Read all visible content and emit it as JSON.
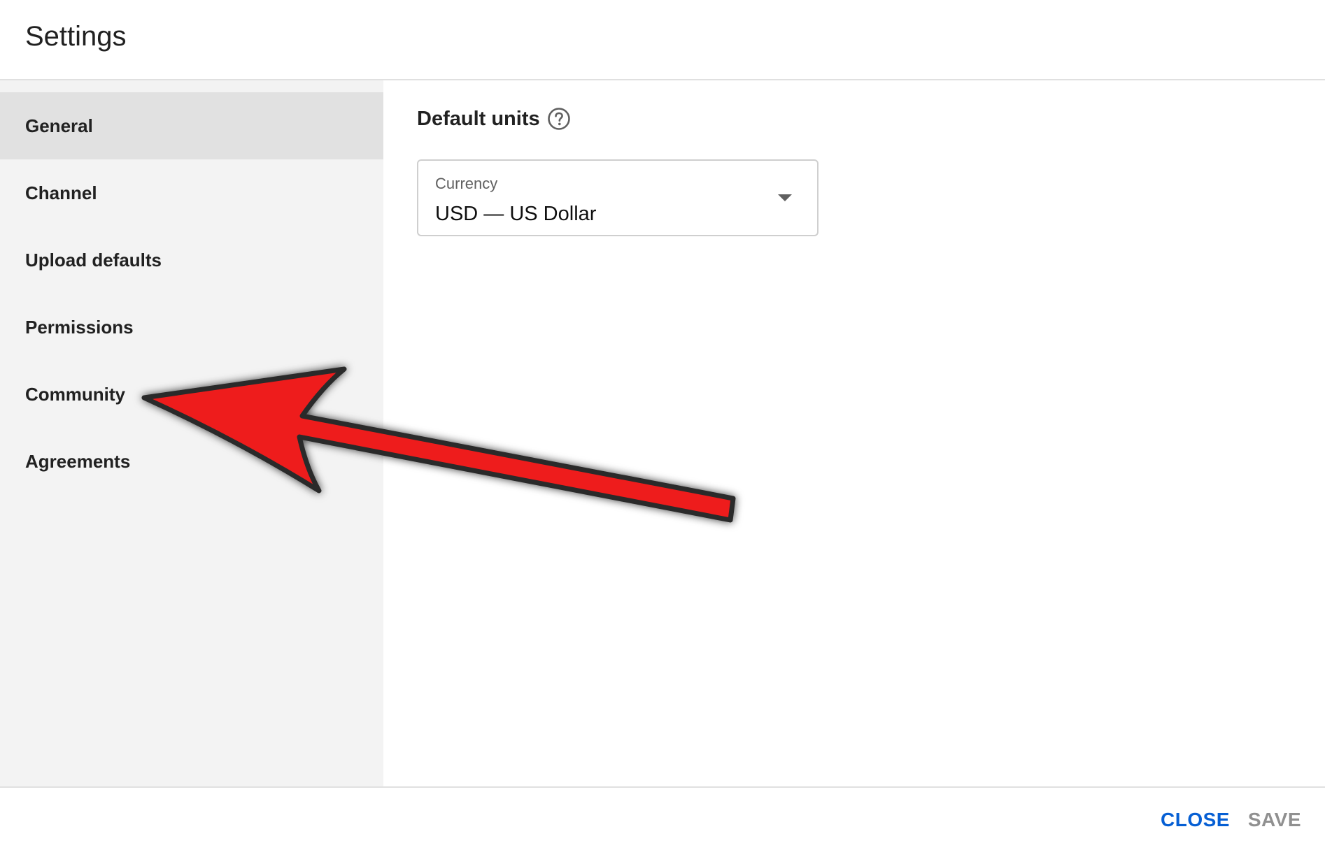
{
  "dialog": {
    "title": "Settings"
  },
  "sidebar": {
    "items": [
      {
        "label": "General",
        "active": true
      },
      {
        "label": "Channel",
        "active": false
      },
      {
        "label": "Upload defaults",
        "active": false
      },
      {
        "label": "Permissions",
        "active": false
      },
      {
        "label": "Community",
        "active": false
      },
      {
        "label": "Agreements",
        "active": false
      }
    ]
  },
  "main": {
    "section_title": "Default units",
    "help_icon": "help-circle-icon",
    "currency_select": {
      "label": "Currency",
      "value": "USD — US Dollar",
      "icon": "dropdown-arrow-icon"
    }
  },
  "footer": {
    "close_label": "CLOSE",
    "save_label": "SAVE"
  },
  "annotation": {
    "icon": "red-arrow-icon",
    "color": "#ee1c1c"
  },
  "colors": {
    "accent": "#065fd4",
    "sidebar_bg": "#f3f3f3",
    "active_bg": "#e1e1e1",
    "disabled_text": "#909090"
  }
}
